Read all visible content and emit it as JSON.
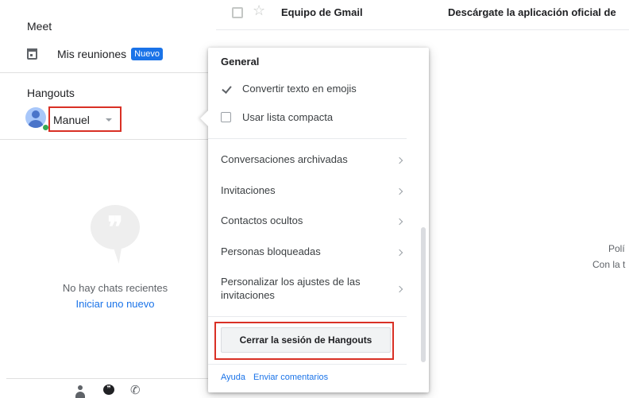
{
  "email_row": {
    "sender": "Equipo de Gmail",
    "subject": "Descárgate la aplicación oficial de"
  },
  "sidebar": {
    "meet": {
      "title": "Meet",
      "my_meetings_label": "Mis reuniones",
      "new_badge": "Nuevo"
    },
    "hangouts": {
      "title": "Hangouts",
      "user_name": "Manuel",
      "presence": "online",
      "empty_text": "No hay chats recientes",
      "start_new_link": "Iniciar uno nuevo",
      "bottom_tabs": [
        "contacts",
        "conversations",
        "phone"
      ]
    }
  },
  "right_fragment": {
    "line1": "Polí",
    "line2": "Con la t"
  },
  "settings_popup": {
    "section_title": "General",
    "options": [
      {
        "label": "Convertir texto en emojis",
        "checked": true
      },
      {
        "label": "Usar lista compacta",
        "checked": false
      }
    ],
    "menu_items": [
      {
        "label": "Conversaciones archivadas"
      },
      {
        "label": "Invitaciones"
      },
      {
        "label": "Contactos ocultos"
      },
      {
        "label": "Personas bloqueadas"
      },
      {
        "label": "Personalizar los ajustes de las invitaciones"
      }
    ],
    "logout_button": "Cerrar la sesión de Hangouts",
    "footer_links": [
      "Ayuda",
      "Enviar comentarios"
    ]
  },
  "colors": {
    "accent_blue": "#1a73e8",
    "highlight_red": "#d93025",
    "presence_green": "#34a853"
  }
}
